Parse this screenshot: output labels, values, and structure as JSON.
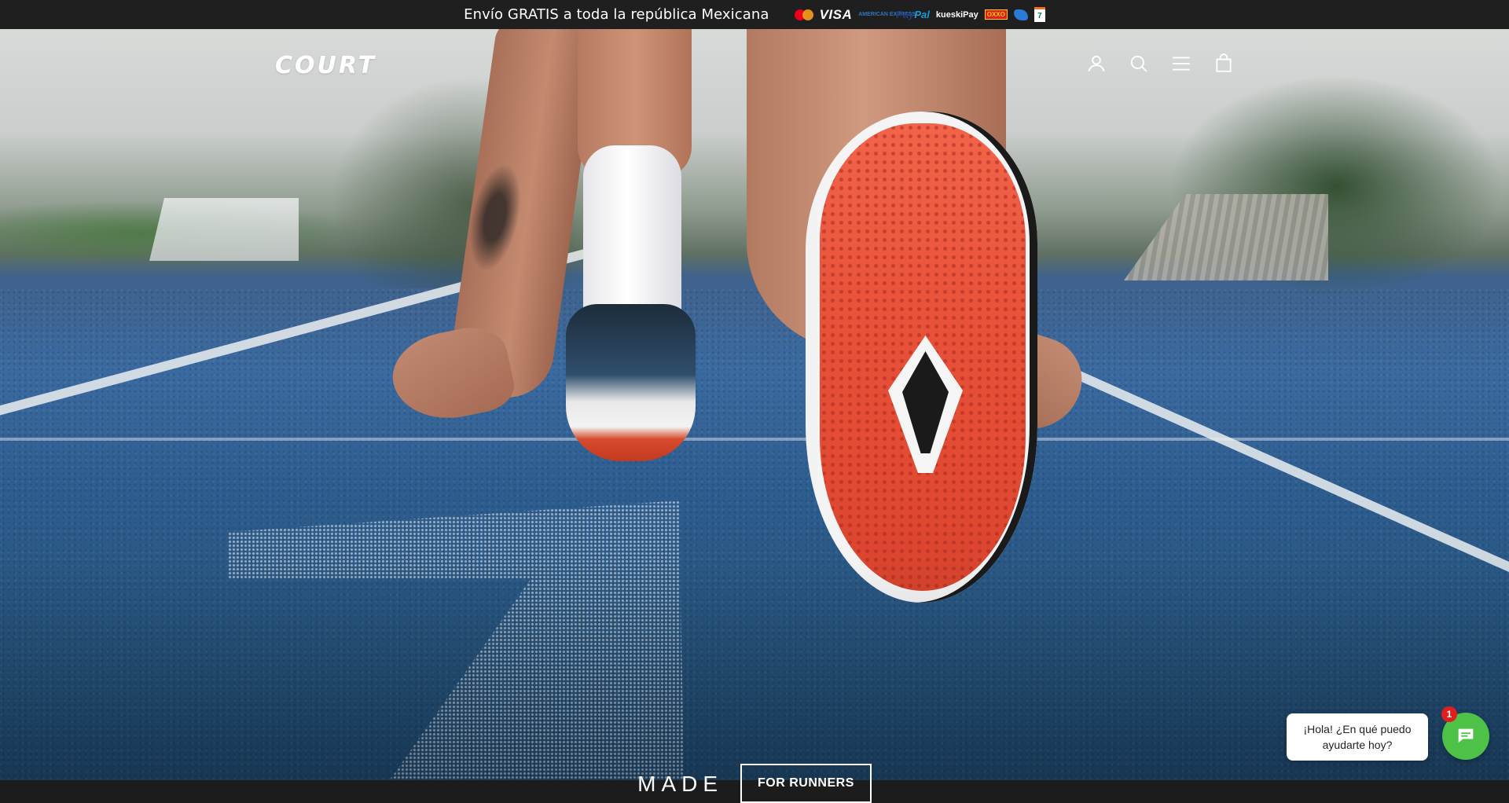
{
  "announcement": {
    "text": "Envío GRATIS a toda la república Mexicana",
    "payment_logos": [
      {
        "name": "mastercard",
        "label": ""
      },
      {
        "name": "visa",
        "label": "VISA"
      },
      {
        "name": "american-express",
        "label": "AMERICAN EXPRESS"
      },
      {
        "name": "paypal",
        "label_a": "Pay",
        "label_b": "Pal"
      },
      {
        "name": "kueskipay",
        "label": "kueskiPay"
      },
      {
        "name": "oxxo",
        "label": "OXXO"
      },
      {
        "name": "other-store",
        "label": ""
      },
      {
        "name": "seven-eleven",
        "label": "7"
      }
    ]
  },
  "header": {
    "logo": "COURT",
    "icons": [
      "account-icon",
      "search-icon",
      "menu-icon",
      "cart-icon"
    ]
  },
  "hero": {
    "tagline_word": "MADE",
    "button_label": "FOR RUNNERS"
  },
  "chat": {
    "bubble_text": "¡Hola! ¿En qué puedo ayudarte hoy?",
    "badge_count": "1"
  },
  "colors": {
    "announcement_bg": "#1f1f1f",
    "chat_green": "#4dc247",
    "badge_red": "#e01e1e",
    "sole_red": "#e8533a"
  }
}
